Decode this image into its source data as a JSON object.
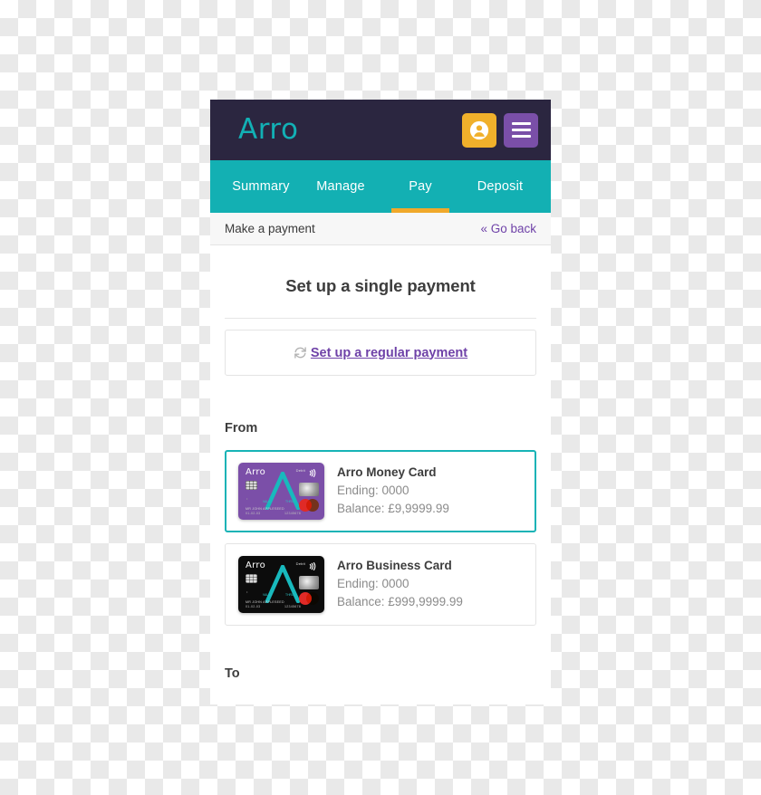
{
  "app": {
    "logo_text": "Arro",
    "brand_teal": "#13b0b3",
    "brand_purple": "#2b2640",
    "brand_amber": "#f0b02b",
    "brand_violet": "#7a4fa8"
  },
  "topbar": {
    "account_icon": "user-avatar-icon",
    "menu_icon": "hamburger-menu-icon"
  },
  "nav": {
    "tabs": [
      {
        "label": "Summary",
        "active": false
      },
      {
        "label": "Manage",
        "active": false
      },
      {
        "label": "Pay",
        "active": true
      },
      {
        "label": "Deposit",
        "active": false
      }
    ]
  },
  "subheader": {
    "title": "Make a payment",
    "back_label": "« Go back"
  },
  "main": {
    "heading": "Set up a single payment",
    "regular_payment": {
      "icon": "refresh-cycle-icon",
      "label": "Set up a regular payment"
    },
    "from_label": "From",
    "to_label": "To",
    "accounts": [
      {
        "name": "Arro Money Card",
        "ending": "Ending: 0000",
        "balance": "Balance: £9,9999.99",
        "selected": true,
        "card_color": "purple",
        "card_logo": "Arro",
        "card_type": "Debit",
        "card_holder": "MR JOHN APPLESEED",
        "card_expiry_left": "01-02-03",
        "card_number": "12345678",
        "card_valid_from": "VALID",
        "card_valid_thru": "THRU"
      },
      {
        "name": "Arro Business Card",
        "ending": "Ending: 0000",
        "balance": "Balance: £999,9999.99",
        "selected": false,
        "card_color": "black",
        "card_logo": "Arro",
        "card_type": "Debit",
        "card_holder": "MR JOHN APPLESEED",
        "card_expiry_left": "01-02-03",
        "card_number": "12345678",
        "card_valid_from": "VALID",
        "card_valid_thru": "THRU"
      }
    ]
  }
}
